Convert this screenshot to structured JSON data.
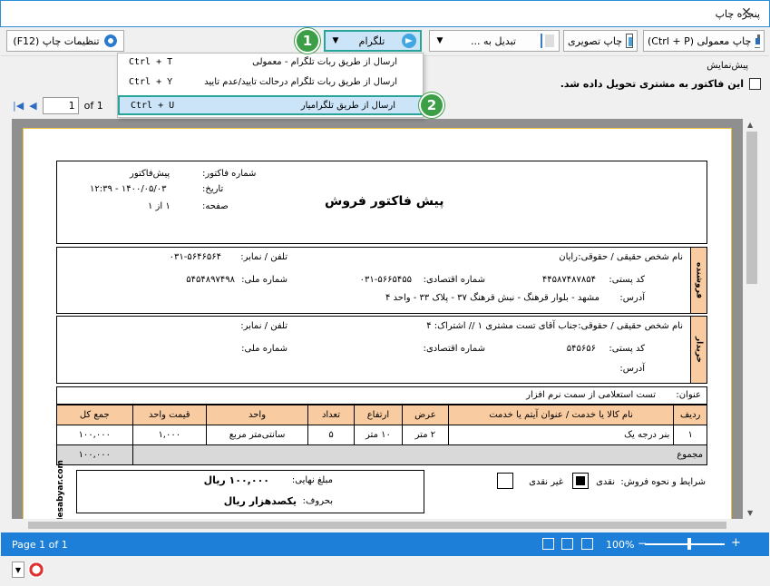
{
  "window": {
    "title": "پنجره چاپ",
    "close_glyph": "✕"
  },
  "toolbar": {
    "print_settings_label": "تنظیمات چاپ (F12)",
    "convert_label": "تبدیل به ...",
    "telegram_label": "تلگرام",
    "image_print_label": "چاپ تصویری",
    "normal_print_label": "چاپ معمولی (Ctrl + P)"
  },
  "telegram_menu": {
    "items": [
      {
        "shortcut": "Ctrl + T",
        "label": "ارسال از طریق ربات تلگرام - معمولی"
      },
      {
        "shortcut": "Ctrl + Y",
        "label": "ارسال از طریق ربات تلگرام درحالت تایید/عدم تایید"
      },
      {
        "shortcut": "Ctrl + U",
        "label": "ارسال از طریق تلگرامیار"
      }
    ],
    "selected_index": 2
  },
  "badges": {
    "one": "1",
    "two": "2"
  },
  "preview": {
    "label": "پیش‌نمایش",
    "delivered_checkbox_label": "این فاکتور به مشتری تحویل داده شد.",
    "delivered_checked": false
  },
  "pager": {
    "current": "1",
    "of_text": "of 1"
  },
  "invoice": {
    "title": "پیش فاکتور فروش",
    "number_label": "شماره فاکتور:",
    "number_value": "پیش‌فاکتور",
    "date_label": "تاریخ:",
    "date_value": "۱۴۰۰/۰۵/۰۳ - ۱۲:۳۹",
    "page_label": "صفحه:",
    "page_value": "۱ از ۱",
    "seller": {
      "side_label": "فروشنده",
      "name_label": "نام شخص حقیقی / حقوقی:",
      "name_value": "رایان",
      "phone_label": "تلفن / نمابر:",
      "phone_value": "۰۳۱-۵۶۴۶۵۶۴",
      "postal_label": "کد پستی:",
      "postal_value": "۴۴۵۸۷۴۸۷۸۵۴",
      "eco_label": "شماره اقتصادی:",
      "eco_value": "۰۳۱-۵۶۶۵۴۵۵",
      "national_label": "شماره ملی:",
      "national_value": "۵۴۵۴۸۹۷۴۹۸",
      "address_label": "آدرس:",
      "address_value": "مشهد - بلوار قرهنگ - نبش قرهنگ ۳۷ - پلاک ۳۳ - واحد ۴"
    },
    "buyer": {
      "side_label": "خریدار",
      "name_label": "نام شخص حقیقی / حقوقی:",
      "name_value": "جناب آقای تست مشتری ۱ // اشتراک: ۴",
      "phone_label": "تلفن / نمابر:",
      "postal_label": "کد پستی:",
      "postal_value": "۵۴۵۶۵۶",
      "eco_label": "شماره اقتصادی:",
      "national_label": "شماره ملی:",
      "address_label": "آدرس:"
    },
    "subject_label": "عنوان:",
    "subject_value": "تست استعلامی از سمت نرم افزار",
    "columns": [
      "ردیف",
      "نام کالا یا خدمت / عنوان آیتم یا خدمت",
      "عرض",
      "ارتفاع",
      "تعداد",
      "واحد",
      "قیمت واحد",
      "جمع کل"
    ],
    "rows": [
      [
        "۱",
        "بنر درجه یک",
        "۲ متر",
        "۱۰ متر",
        "۵",
        "سانتی‌متر مربع",
        "۱,۰۰۰",
        "۱۰۰,۰۰۰"
      ]
    ],
    "sum_label": "مجموع",
    "sum_value": "۱۰۰,۰۰۰",
    "terms_label": "شرایط و نحوه فروش:",
    "cash_label": "نقدی",
    "noncash_label": "غیر نقدی",
    "final_label": "مبلغ نهایی:",
    "final_value": "۱۰۰,۰۰۰ ریال",
    "words_label": "بحروف:",
    "words_value": "یکصدهزار ریال",
    "brand": "Hesabyar.com"
  },
  "status": {
    "page_text": "Page 1 of 1",
    "zoom": "100%",
    "minus": "−",
    "plus": "+"
  }
}
